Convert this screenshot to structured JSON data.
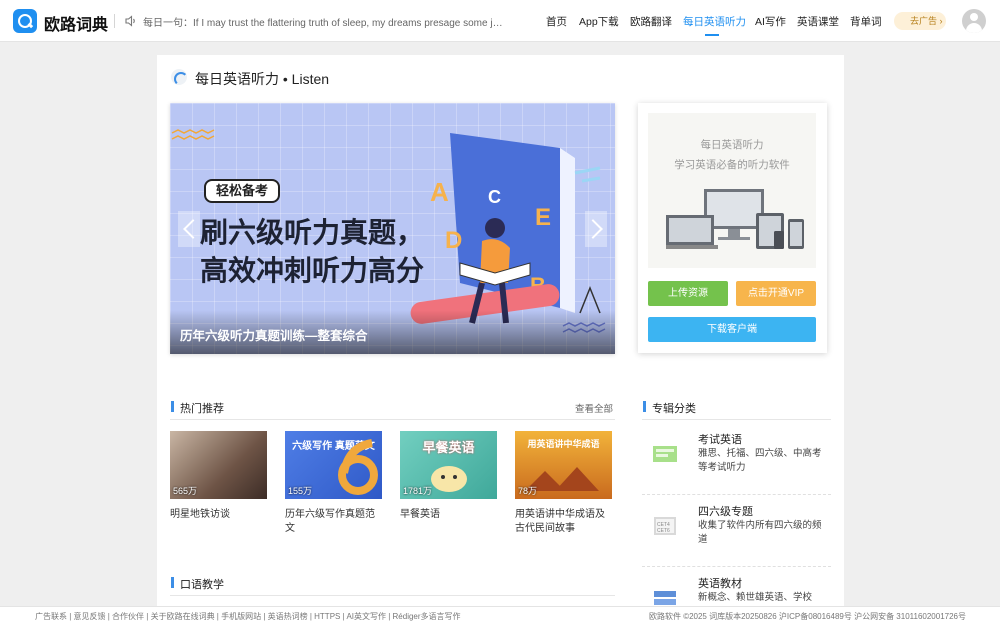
{
  "header": {
    "brand": "欧路词典",
    "daily_sentence": "每日一句：If I may trust the flattering truth of sleep, my dreams presage some jo...",
    "nav": [
      "首页",
      "App下载",
      "欧路翻译",
      "每日英语听力",
      "AI写作",
      "英语课堂",
      "背单词"
    ],
    "active_nav": "每日英语听力",
    "ad_label": "去广告 ›"
  },
  "page": {
    "title": "每日英语听力 • Listen"
  },
  "banner": {
    "tag": "轻松备考",
    "line1": "刷六级听力真题，",
    "line2": "高效冲刺听力高分",
    "caption": "历年六级听力真题训练—整套综合"
  },
  "promo": {
    "title": "每日英语听力",
    "subtitle": "学习英语必备的听力软件",
    "upload_label": "上传资源",
    "vip_label": "点击开通VIP",
    "download_label": "下载客户端"
  },
  "hot": {
    "title": "热门推荐",
    "see_all": "查看全部",
    "items": [
      {
        "label": "明星地铁访谈",
        "count": "565万",
        "overlay": "",
        "color": "#8a7060"
      },
      {
        "label": "历年六级写作真题范文",
        "count": "155万",
        "overlay": "六级写作 真题范文",
        "color": "#3a6bd0"
      },
      {
        "label": "早餐英语",
        "count": "1781万",
        "overlay": "早餐英语",
        "color": "#5fc0b0"
      },
      {
        "label": "用英语讲中华成语及古代民间故事",
        "count": "78万",
        "overlay": "用英语讲中华成语",
        "color": "#e08a2a"
      }
    ]
  },
  "oral": {
    "title": "口语教学"
  },
  "albums": {
    "title": "专辑分类",
    "items": [
      {
        "title": "考试英语",
        "desc": "雅思、托福、四六级、中高考等考试听力"
      },
      {
        "title": "四六级专题",
        "desc": "收集了软件内所有四六级的频道"
      },
      {
        "title": "英语教材",
        "desc": "新概念、赖世雄英语、学校"
      }
    ]
  },
  "footer": {
    "links": "广告联系 | 意见反馈 | 合作伙伴 | 关于欧路在线词典 | 手机版网站 | 英语热词榜 | HTTPS | AI英文写作 | Rédiger多语言写作",
    "copyright": "欧路软件 ©2025 词库版本20250826 沪ICP备08016489号 沪公网安备 31011602001726号"
  },
  "colors": {
    "accent": "#1f8ff0",
    "upload": "#74c24c",
    "vip": "#f7b54c",
    "download": "#3cb4f2"
  }
}
